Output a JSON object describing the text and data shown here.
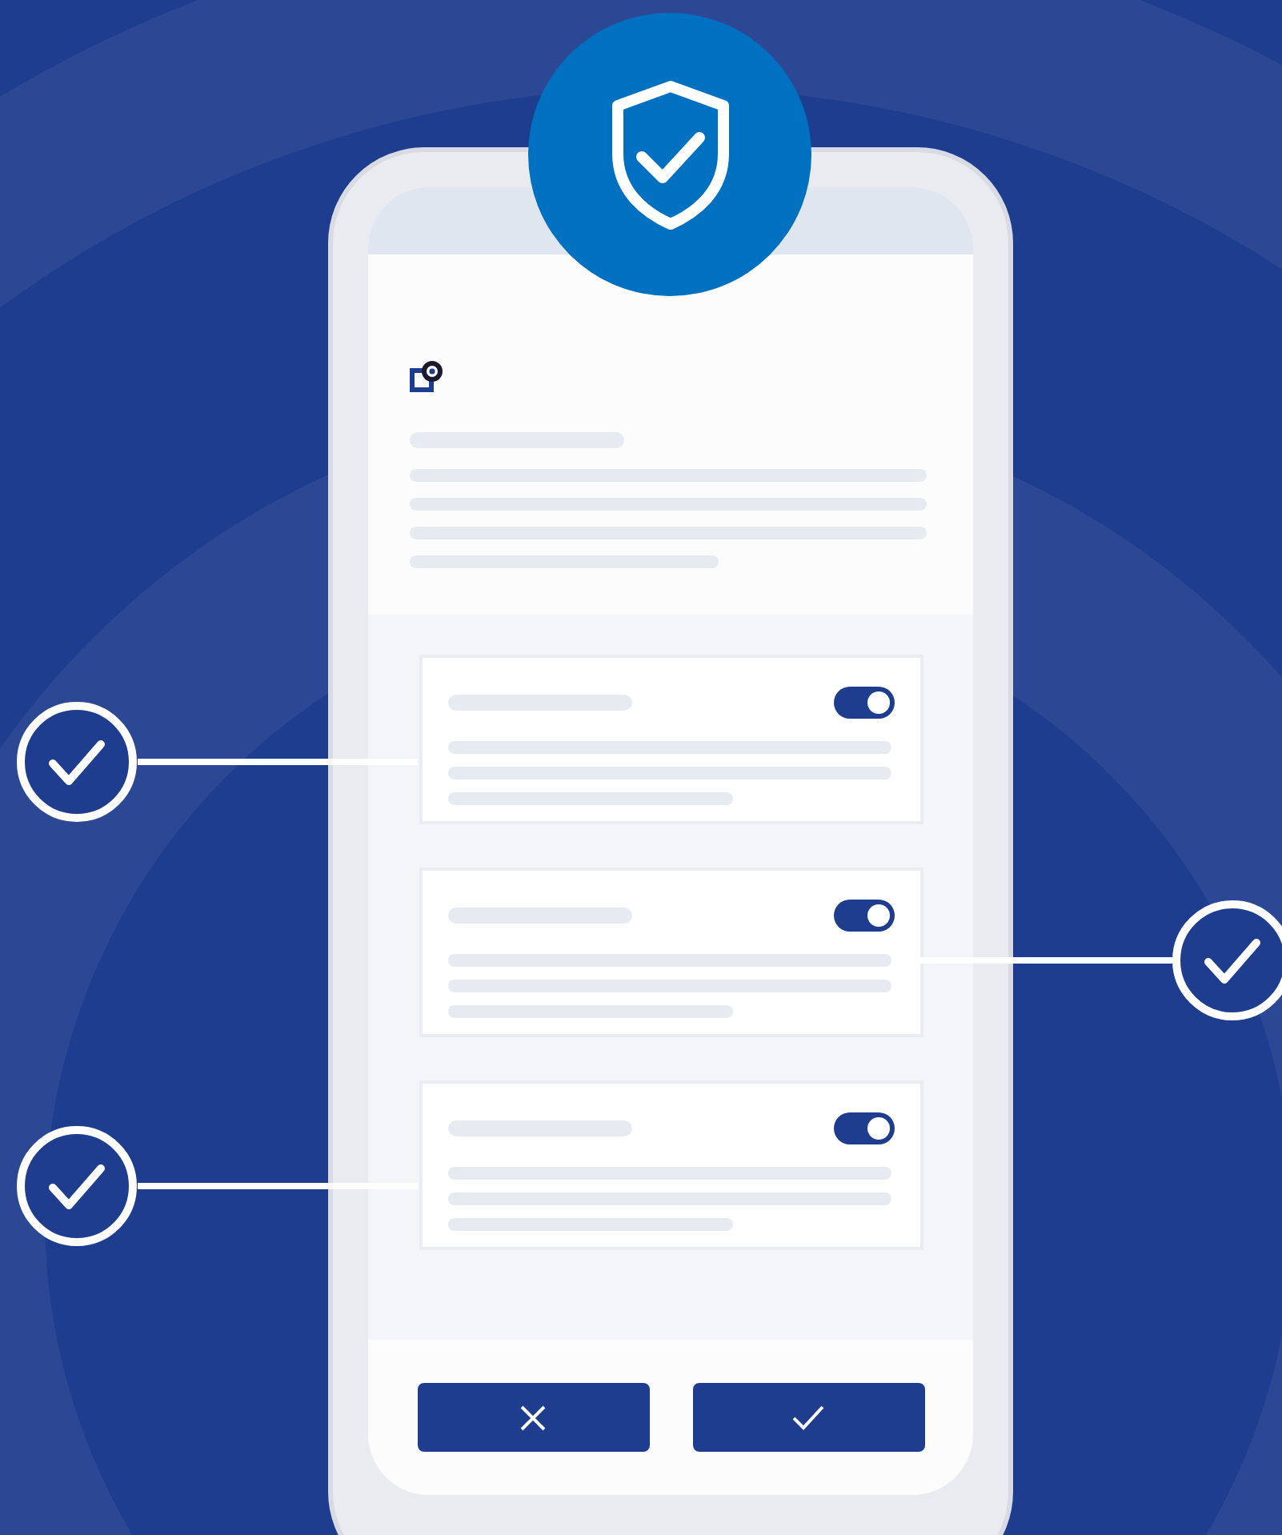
{
  "cards": [
    {
      "toggle_on": true,
      "kind": "left"
    },
    {
      "toggle_on": true,
      "kind": "right"
    },
    {
      "toggle_on": true,
      "kind": "left"
    }
  ],
  "buttons": [
    {
      "kind": "cancel"
    },
    {
      "kind": "confirm"
    }
  ]
}
